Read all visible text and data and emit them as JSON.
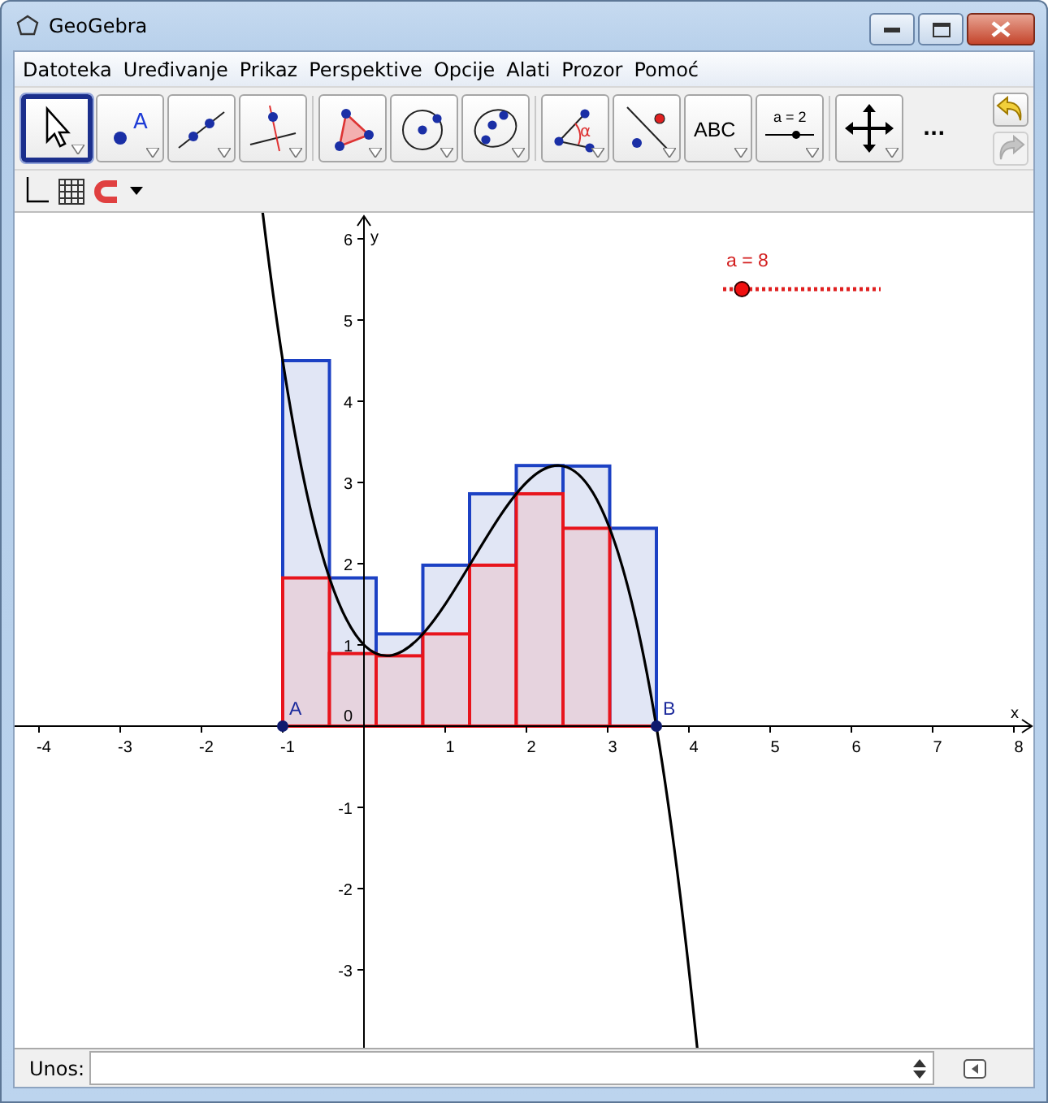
{
  "window": {
    "title": "GeoGebra"
  },
  "menu": [
    "Datoteka",
    "Uređivanje",
    "Prikaz",
    "Perspektive",
    "Opcije",
    "Alati",
    "Prozor",
    "Pomoć"
  ],
  "tool_groups": [
    [
      {
        "kind": "move",
        "selected": true
      },
      {
        "kind": "point",
        "label": "A",
        "selected": false
      },
      {
        "kind": "line",
        "selected": false
      },
      {
        "kind": "perpendicular",
        "selected": false
      }
    ],
    [
      {
        "kind": "polygon",
        "selected": false
      },
      {
        "kind": "circle",
        "selected": false
      },
      {
        "kind": "conic",
        "selected": false
      }
    ],
    [
      {
        "kind": "angle",
        "label": "α",
        "selected": false
      },
      {
        "kind": "reflect",
        "selected": false
      },
      {
        "kind": "text",
        "label": "ABC",
        "selected": false
      },
      {
        "kind": "slider",
        "label": "a = 2",
        "selected": false
      }
    ],
    [
      {
        "kind": "move-view",
        "selected": false
      }
    ]
  ],
  "more_tools": "...",
  "undo": {
    "disabled": false
  },
  "redo": {
    "disabled": true
  },
  "graphics": {
    "x_ticks": [
      "-4",
      "-3",
      "-2",
      "-1",
      "1",
      "2",
      "3",
      "4",
      "5",
      "6",
      "7",
      "8"
    ],
    "y_ticks": [
      "6",
      "5",
      "4",
      "3",
      "2",
      "1",
      "-1",
      "-2",
      "-3"
    ],
    "origin_label": "0",
    "x_axis_label": "x",
    "y_axis_label": "y",
    "points": [
      {
        "label": "A"
      },
      {
        "label": "B"
      }
    ],
    "slider": {
      "label": "a = 8",
      "level": 0.12
    }
  },
  "input_bar": {
    "label": "Unos:"
  }
}
